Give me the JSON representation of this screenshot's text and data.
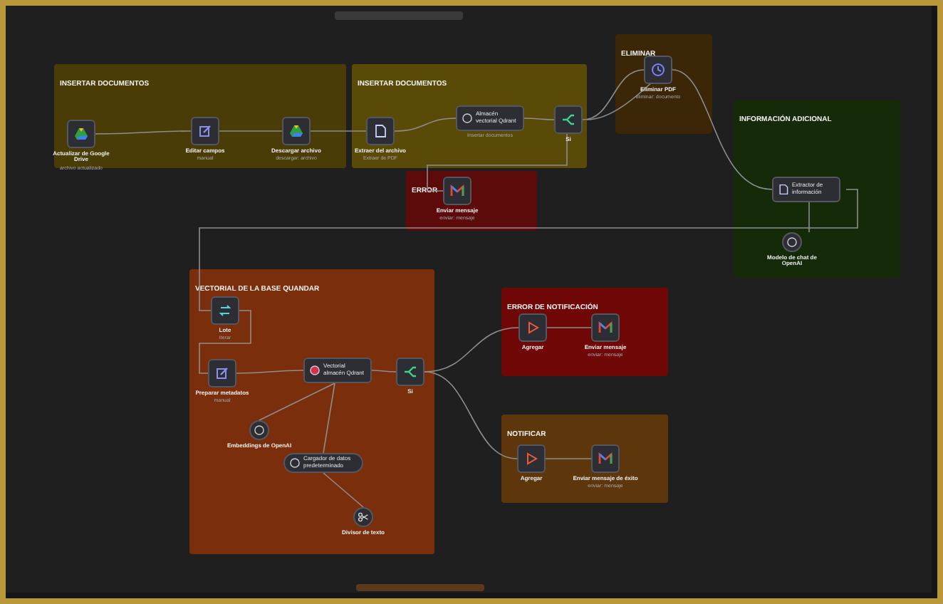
{
  "groups": [
    {
      "title": "INSERTAR DOCUMENTOS",
      "color": "#4a3c06"
    },
    {
      "title": "INSERTAR DOCUMENTOS",
      "color": "#5a4a07"
    },
    {
      "title": "ELIMINAR",
      "color": "#3c2608"
    },
    {
      "title": "INFORMACIÓN ADICIONAL",
      "color": "#142a08"
    },
    {
      "title": "ERROR",
      "color": "#5c0a0a"
    },
    {
      "title": "VECTORIAL DE LA BASE QUANDAR",
      "color": "#7a2e0b"
    },
    {
      "title": "ERROR DE NOTIFICACIÓN",
      "color": "#700707"
    },
    {
      "title": "NOTIFICAR",
      "color": "#5e360c"
    }
  ],
  "nodes": [
    {
      "kind": "square",
      "label": "Actualizar de Google Drive",
      "subtitle": "archivo actualizado"
    },
    {
      "kind": "square",
      "label": "Editar campos",
      "subtitle": "manual"
    },
    {
      "kind": "square",
      "label": "Descargar archivo",
      "subtitle": "descargar: archivo"
    },
    {
      "kind": "square",
      "label": "Extraer del archivo",
      "subtitle": "Extraer de PDF"
    },
    {
      "kind": "wide",
      "label": "Almacén vectorial Qdrant",
      "subtitle": "Insertar documentos"
    },
    {
      "kind": "square",
      "label": "Si"
    },
    {
      "kind": "square",
      "label": "Eliminar PDF",
      "subtitle": "eliminar: documento"
    },
    {
      "kind": "wide",
      "label": "Extractor de información"
    },
    {
      "kind": "circle",
      "label": "Modelo de chat de OpenAI"
    },
    {
      "kind": "square",
      "label": "Enviar mensaje",
      "subtitle": "enviar: mensaje"
    },
    {
      "kind": "square",
      "label": "Lote",
      "subtitle": "Iterar"
    },
    {
      "kind": "square",
      "label": "Preparar metadatos",
      "subtitle": "manual"
    },
    {
      "kind": "wide",
      "label": "Vectorial almacén Qdrant"
    },
    {
      "kind": "square",
      "label": "Si"
    },
    {
      "kind": "circle",
      "label": "Embeddings de OpenAI"
    },
    {
      "kind": "pill",
      "label": "Cargador de datos predeterminado"
    },
    {
      "kind": "circle",
      "label": "Divisor de texto"
    },
    {
      "kind": "square",
      "label": "Agregar"
    },
    {
      "kind": "square",
      "label": "Enviar mensaje",
      "subtitle": "enviar: mensaje"
    },
    {
      "kind": "square",
      "label": "Agregar"
    },
    {
      "kind": "square",
      "label": "Enviar mensaje de éxito",
      "subtitle": "enviar: mensaje"
    }
  ]
}
